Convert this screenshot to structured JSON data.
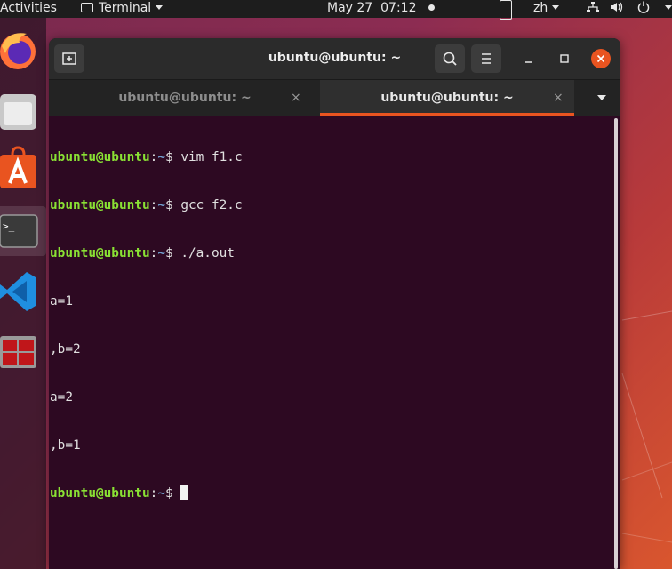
{
  "topbar": {
    "activities": "Activities",
    "app_menu": "Terminal",
    "date": "May 27",
    "time": "07:12",
    "lang": "zh"
  },
  "dock": {
    "apps": [
      {
        "icon": "firefox-icon"
      },
      {
        "icon": "files-icon"
      },
      {
        "icon": "software-icon"
      },
      {
        "icon": "terminal-icon",
        "active": true
      },
      {
        "icon": "vscode-icon"
      },
      {
        "icon": "terminator-icon"
      }
    ]
  },
  "window": {
    "title": "ubuntu@ubuntu: ~",
    "tabs": [
      {
        "label": "ubuntu@ubuntu: ~",
        "close": "×"
      },
      {
        "label": "ubuntu@ubuntu: ~",
        "close": "×"
      }
    ]
  },
  "terminal": {
    "prompt_user": "ubuntu@ubuntu",
    "prompt_colon": ":",
    "prompt_path": "~",
    "prompt_sym": "$ ",
    "commands": [
      "vim f1.c",
      "gcc f2.c",
      "./a.out"
    ],
    "output": [
      "a=1",
      ",b=2",
      "a=2",
      ",b=1"
    ]
  },
  "colors": {
    "terminal_bg": "#2d0922",
    "prompt_user": "#8ae234",
    "prompt_path": "#729fcf",
    "tab_accent": "#e95420"
  }
}
